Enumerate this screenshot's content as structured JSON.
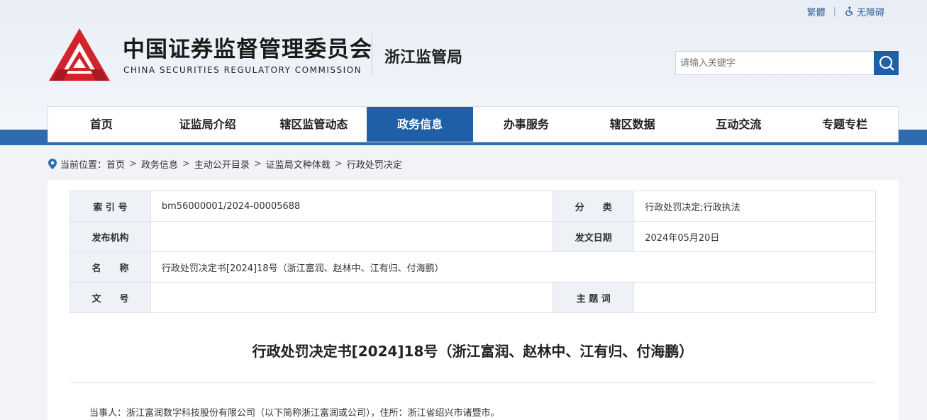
{
  "toplinks": {
    "traditional": "繁體",
    "separator": "|",
    "accessibility": "无障碍"
  },
  "header": {
    "org_name_cn": "中国证券监督管理委员会",
    "org_name_en": "CHINA SECURITIES REGULATORY COMMISSION",
    "bureau": "浙江监管局"
  },
  "search": {
    "placeholder": "请输入关键字"
  },
  "colors": {
    "brand_blue": "#1f5fa8",
    "logo_red": "#d2232a"
  },
  "nav": {
    "items": [
      {
        "label": "首页"
      },
      {
        "label": "证监局介绍"
      },
      {
        "label": "辖区监管动态"
      },
      {
        "label": "政务信息"
      },
      {
        "label": "办事服务"
      },
      {
        "label": "辖区数据"
      },
      {
        "label": "互动交流"
      },
      {
        "label": "专题专栏"
      }
    ],
    "active": "政务信息"
  },
  "breadcrumb": {
    "prefix": "当前位置：",
    "items": [
      "首页",
      "政务信息",
      "主动公开目录",
      "证监局文种体裁",
      "行政处罚决定"
    ],
    "separator": ">"
  },
  "info": {
    "index_label": "索 引 号",
    "index_value": "bm56000001/2024-00005688",
    "category_label": "分　　类",
    "category_value": "行政处罚决定;行政执法",
    "publisher_label": "发布机构",
    "publisher_value": "",
    "date_label": "发文日期",
    "date_value": "2024年05月20日",
    "name_label": "名　　称",
    "name_value": "行政处罚决定书[2024]18号（浙江富润、赵林中、江有归、付海鹏）",
    "docno_label": "文　　号",
    "docno_value": "",
    "keywords_label": "主 题 词",
    "keywords_value": ""
  },
  "document": {
    "title": "行政处罚决定书[2024]18号（浙江富润、赵林中、江有归、付海鹏）",
    "first_line": "当事人：浙江富润数字科技股份有限公司（以下简称浙江富润或公司），住所：浙江省绍兴市诸暨市。"
  }
}
